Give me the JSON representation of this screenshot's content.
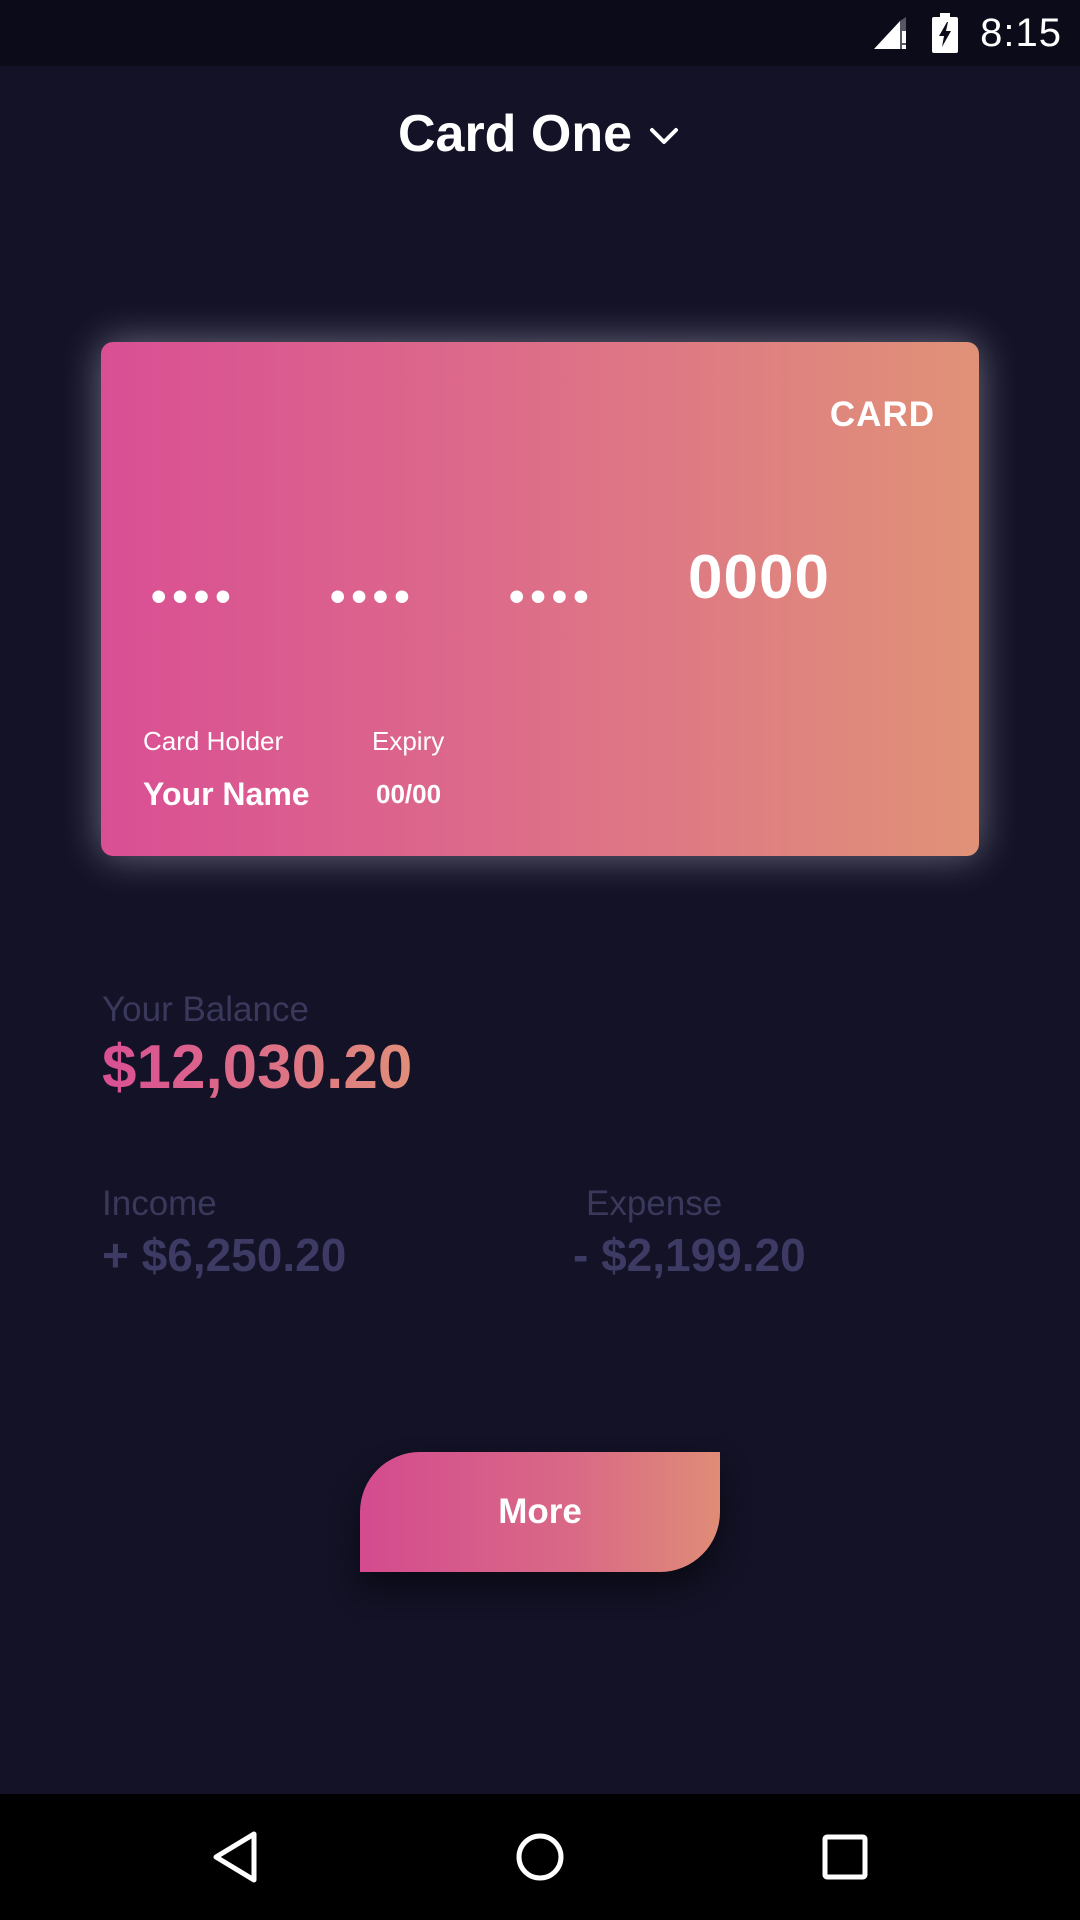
{
  "status_bar": {
    "time": "8:15",
    "icons": [
      "signal-alert-icon",
      "battery-charging-icon"
    ]
  },
  "header": {
    "title": "Card One",
    "dropdown_icon": "chevron-down-icon"
  },
  "card": {
    "brand": "CARD",
    "number_groups": [
      "••••",
      "••••",
      "••••"
    ],
    "last_four": "0000",
    "holder_label": "Card Holder",
    "holder_name": "Your Name",
    "expiry_label": "Expiry",
    "expiry_value": "00/00"
  },
  "balance": {
    "label": "Your Balance",
    "value": "$12,030.20"
  },
  "income": {
    "label": "Income",
    "value": "+ $6,250.20"
  },
  "expense": {
    "label": "Expense",
    "value": "- $2,199.20"
  },
  "actions": {
    "more_label": "More"
  },
  "navigation": {
    "buttons": [
      "back-icon",
      "home-icon",
      "recents-icon"
    ]
  },
  "colors": {
    "background": "#131226",
    "accent_start": "#d94f94",
    "accent_end": "#e0927a",
    "muted_text": "#3a385b"
  }
}
